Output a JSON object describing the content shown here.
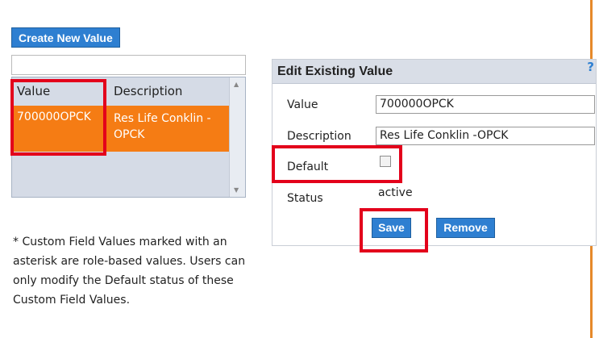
{
  "toolbar": {
    "create_label": "Create New Value"
  },
  "values_list": {
    "columns": [
      "Value",
      "Description"
    ],
    "rows": [
      {
        "value": "700000OPCK",
        "description": "Res Life Conklin -OPCK"
      }
    ]
  },
  "note": "* Custom Field Values marked with an asterisk are role-based values. Users can only modify the Default status of these Custom Field Values.",
  "edit_panel": {
    "title": "Edit Existing Value",
    "help": "?",
    "value_label": "Value",
    "value": "700000OPCK",
    "description_label": "Description",
    "description": "Res Life Conklin -OPCK",
    "default_label": "Default",
    "status_label": "Status",
    "status": "active",
    "save_label": "Save",
    "remove_label": "Remove"
  },
  "colors": {
    "accent_blue": "#2e7fd1",
    "selected_row": "#f57c14",
    "highlight_red": "#e3001b"
  }
}
